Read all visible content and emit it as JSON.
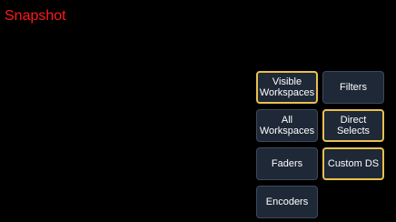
{
  "window": {
    "title": "Snapshot"
  },
  "buttons": {
    "visible_workspaces": {
      "label": "Visible\nWorkspaces",
      "selected": true
    },
    "filters": {
      "label": "Filters",
      "selected": false
    },
    "all_workspaces": {
      "label": "All\nWorkspaces",
      "selected": false
    },
    "direct_selects": {
      "label": "Direct\nSelects",
      "selected": true
    },
    "faders": {
      "label": "Faders",
      "selected": false
    },
    "custom_ds": {
      "label": "Custom DS",
      "selected": true
    },
    "encoders": {
      "label": "Encoders",
      "selected": false
    }
  },
  "colors": {
    "background": "#000000",
    "title": "#ff1a1a",
    "button_fill": "#1e2836",
    "button_border": "#3c4a5c",
    "selected_border": "#e8c050",
    "button_text": "#ffffff"
  }
}
